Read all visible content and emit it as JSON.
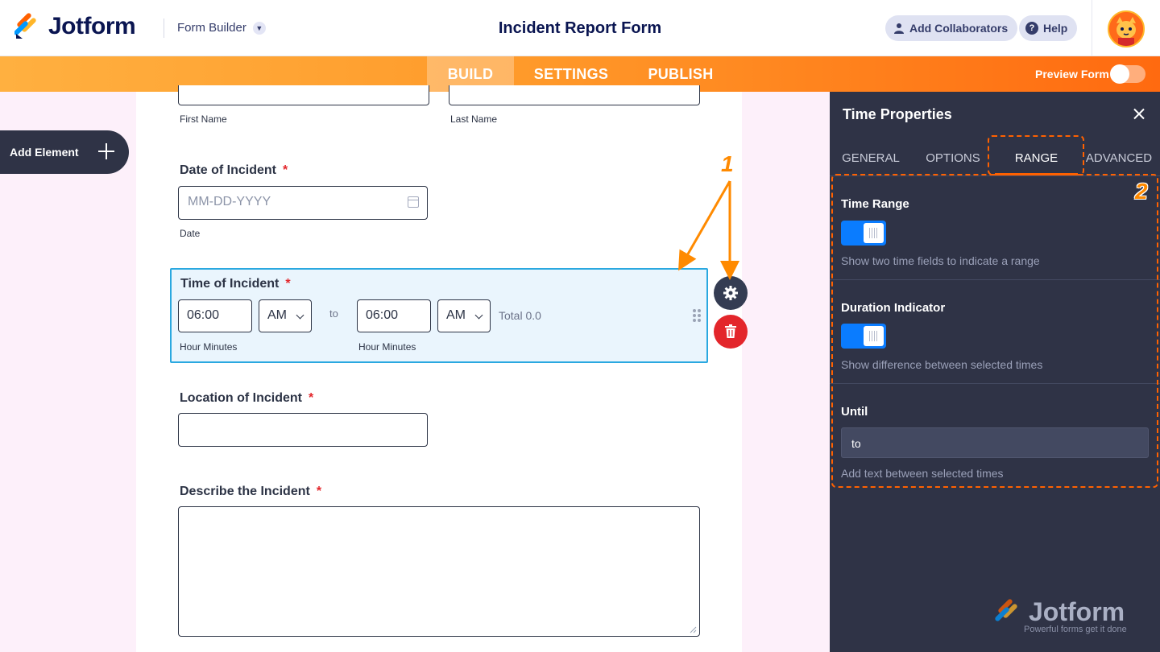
{
  "header": {
    "brand": "Jotform",
    "form_builder_label": "Form Builder",
    "form_title": "Incident Report Form",
    "add_collaborators": "Add Collaborators",
    "help": "Help",
    "help_icon_glyph": "?"
  },
  "nav": {
    "tabs": [
      "BUILD",
      "SETTINGS",
      "PUBLISH"
    ],
    "active_tab": "BUILD",
    "preview_label": "Preview Form",
    "preview_on": false
  },
  "sidebar": {
    "add_element": "Add Element"
  },
  "form": {
    "name_sublabels": {
      "first": "First Name",
      "last": "Last Name"
    },
    "date_field": {
      "label": "Date of Incident",
      "required_mark": "*",
      "placeholder": "MM-DD-YYYY",
      "sublabel": "Date"
    },
    "time_field": {
      "label": "Time of Incident",
      "required_mark": "*",
      "start_time": "06:00",
      "start_ampm": "AM",
      "separator": "to",
      "end_time": "06:00",
      "end_ampm": "AM",
      "total": "Total 0.0",
      "start_sublabel": "Hour Minutes",
      "end_sublabel": "Hour Minutes"
    },
    "location_field": {
      "label": "Location of Incident",
      "required_mark": "*"
    },
    "describe_field": {
      "label": "Describe the Incident",
      "required_mark": "*"
    }
  },
  "panel": {
    "title": "Time Properties",
    "tabs": [
      "GENERAL",
      "OPTIONS",
      "RANGE",
      "ADVANCED"
    ],
    "active_tab": "RANGE",
    "time_range": {
      "title": "Time Range",
      "enabled": true,
      "description": "Show two time fields to indicate a range"
    },
    "duration": {
      "title": "Duration Indicator",
      "enabled": true,
      "description": "Show difference between selected times"
    },
    "until": {
      "title": "Until",
      "value": "to",
      "description": "Add text between selected times"
    },
    "watermark": {
      "brand": "Jotform",
      "tagline": "Powerful forms get it done"
    }
  },
  "annotations": {
    "marker1": "1",
    "marker2": "2"
  },
  "colors": {
    "accent_orange": "#ff6100",
    "panel_bg": "#2f3346",
    "toggle_blue": "#0a7cff",
    "selection_blue": "#2aa8e0",
    "required_red": "#e3262b"
  }
}
